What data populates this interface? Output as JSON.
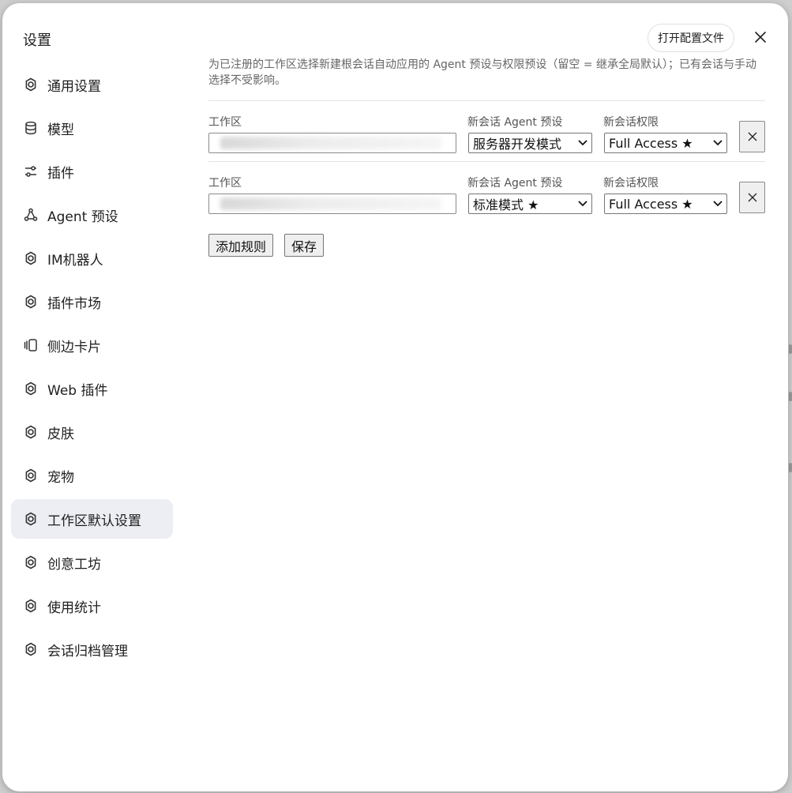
{
  "sidebar": {
    "title": "设置",
    "items": [
      {
        "label": "通用设置",
        "icon": "gear-icon"
      },
      {
        "label": "模型",
        "icon": "database-icon"
      },
      {
        "label": "插件",
        "icon": "sliders-icon"
      },
      {
        "label": "Agent 预设",
        "icon": "nodes-icon"
      },
      {
        "label": "IM机器人",
        "icon": "gear-icon"
      },
      {
        "label": "插件市场",
        "icon": "gear-icon"
      },
      {
        "label": "侧边卡片",
        "icon": "cards-icon"
      },
      {
        "label": "Web 插件",
        "icon": "gear-icon"
      },
      {
        "label": "皮肤",
        "icon": "gear-icon"
      },
      {
        "label": "宠物",
        "icon": "gear-icon"
      },
      {
        "label": "工作区默认设置",
        "icon": "gear-icon",
        "active": true
      },
      {
        "label": "创意工坊",
        "icon": "gear-icon"
      },
      {
        "label": "使用统计",
        "icon": "gear-icon"
      },
      {
        "label": "会话归档管理",
        "icon": "gear-icon"
      }
    ]
  },
  "header": {
    "open_config_label": "打开配置文件"
  },
  "main": {
    "description": "为已注册的工作区选择新建根会话自动应用的 Agent 预设与权限预设（留空 = 继承全局默认）；已有会话与手动选择不受影响。",
    "rules": [
      {
        "workspace_label": "工作区",
        "agent_label": "新会话 Agent 预设",
        "agent_value": "服务器开发模式",
        "permission_label": "新会话权限",
        "permission_value": "Full Access ★"
      },
      {
        "workspace_label": "工作区",
        "agent_label": "新会话 Agent 预设",
        "agent_value": "标准模式 ★",
        "permission_label": "新会话权限",
        "permission_value": "Full Access ★"
      }
    ],
    "add_rule_label": "添加规则",
    "save_label": "保存"
  }
}
